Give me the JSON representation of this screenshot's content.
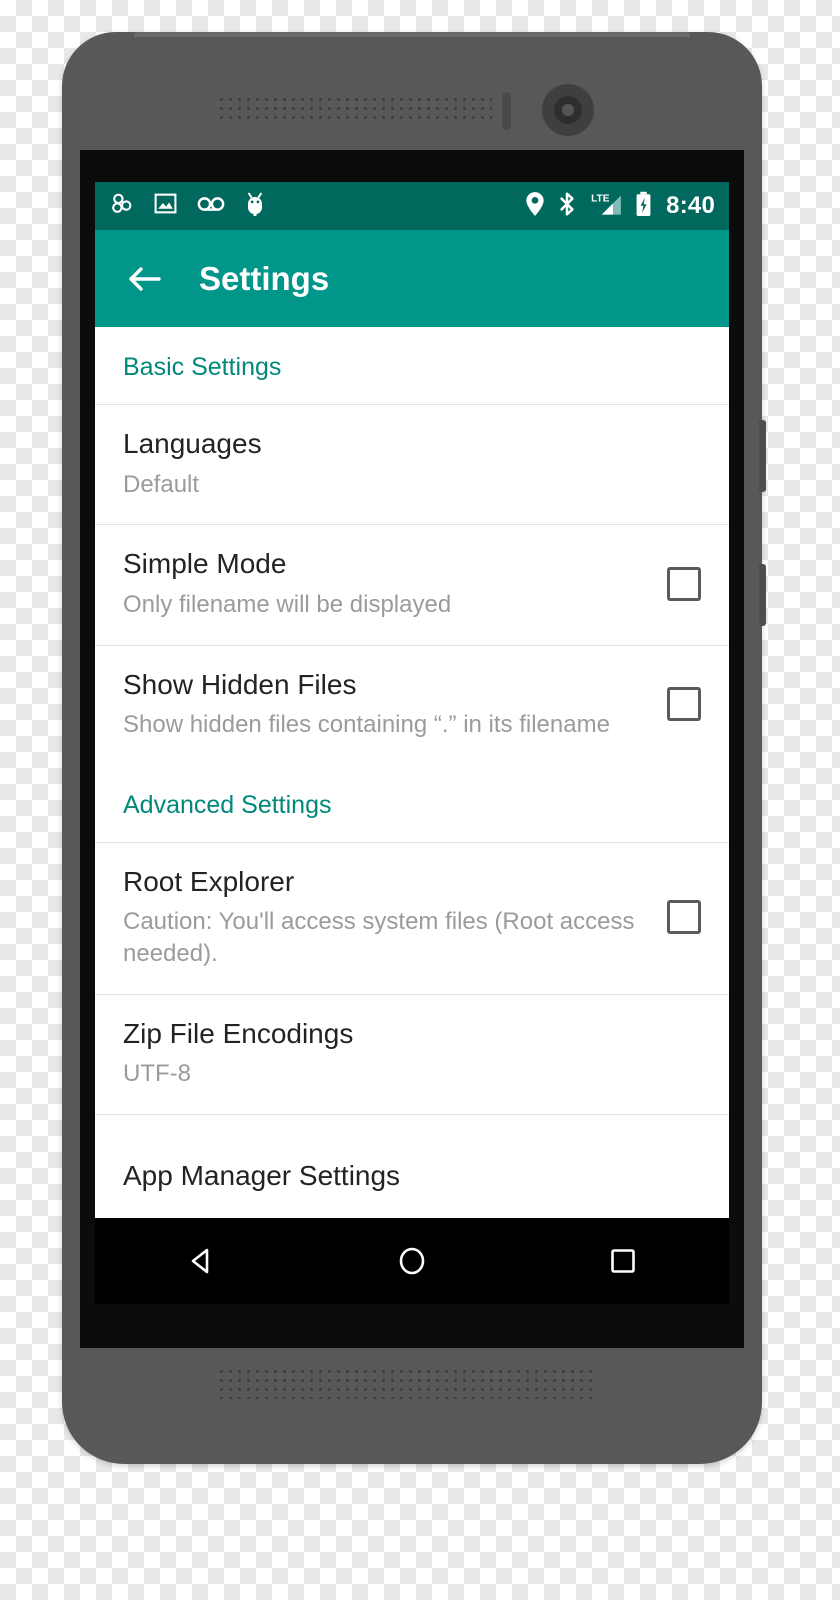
{
  "device": {
    "hardware": {
      "earpiece_speaker": "earpiece-speaker-grille",
      "proximity_sensor": "proximity-sensor",
      "front_camera": "front-camera",
      "bottom_speaker": "bottom-speaker-grille",
      "volume_button": "volume-button",
      "power_button": "power-button"
    },
    "colors": {
      "body": "#585858",
      "bezel": "#0c0c0c"
    }
  },
  "status_bar": {
    "background": "#00685c",
    "clock": "8:40",
    "left_icons": [
      {
        "name": "cluster-bubbles-icon"
      },
      {
        "name": "image-icon"
      },
      {
        "name": "voicemail-icon"
      },
      {
        "name": "android-usb-icon"
      }
    ],
    "right_icons": [
      {
        "name": "location-pin-icon"
      },
      {
        "name": "bluetooth-icon"
      },
      {
        "name": "lte-signal-icon",
        "label": "LTE"
      },
      {
        "name": "battery-charging-icon"
      }
    ]
  },
  "app_bar": {
    "background": "#00968a",
    "back_icon": "back-arrow-icon",
    "title": "Settings"
  },
  "settings": {
    "accent_color": "#00897b",
    "sections": [
      {
        "header": "Basic Settings",
        "items": [
          {
            "title": "Languages",
            "summary": "Default",
            "has_checkbox": false
          },
          {
            "title": "Simple Mode",
            "summary": "Only filename will be displayed",
            "has_checkbox": true,
            "checked": false
          },
          {
            "title": "Show Hidden Files",
            "summary": "Show hidden files containing “.” in its filename",
            "has_checkbox": true,
            "checked": false
          }
        ]
      },
      {
        "header": "Advanced Settings",
        "items": [
          {
            "title": "Root Explorer",
            "summary": "Caution: You'll access system files (Root access needed).",
            "has_checkbox": true,
            "checked": false
          },
          {
            "title": "Zip File Encodings",
            "summary": "UTF-8",
            "has_checkbox": false
          }
        ]
      },
      {
        "header": null,
        "items": [
          {
            "title": "App Manager Settings",
            "summary": null,
            "has_checkbox": false
          }
        ]
      }
    ]
  },
  "nav_bar": {
    "background": "#000000",
    "buttons": [
      {
        "name": "nav-back-button"
      },
      {
        "name": "nav-home-button"
      },
      {
        "name": "nav-recents-button"
      }
    ]
  }
}
